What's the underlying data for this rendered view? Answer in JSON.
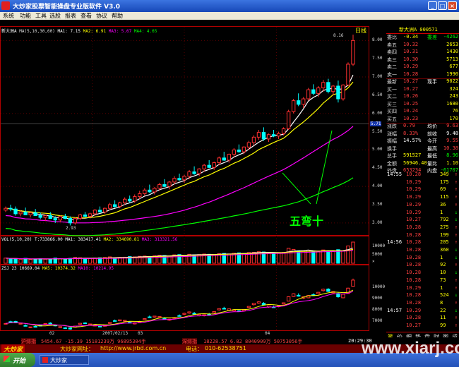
{
  "window": {
    "title": "大炒家股票智能操盘专业版软件 V3.0",
    "buttons": {
      "minimize": "_",
      "maximize": "□",
      "close": "×"
    }
  },
  "menu": [
    "系统",
    "功能",
    "工具",
    "选股",
    "报表",
    "查看",
    "协议",
    "帮助"
  ],
  "chart": {
    "stock_name": "新大洲A",
    "period_label": "日线",
    "ma_labels": {
      "header": "MA(5,10,30,60)",
      "ma1": "MA1: 7.15",
      "ma2": "MA2: 6.91",
      "ma3": "MA3: 5.67",
      "ma4": "MA4: 4.65"
    },
    "price_axis": [
      "8.00",
      "7.50",
      "7.00",
      "6.50",
      "6.00",
      "5.50",
      "5.00",
      "4.50",
      "4.00",
      "3.50",
      "3.00"
    ],
    "high_label": "8.16",
    "low_label": "2.93",
    "crosshair_value": "5.71",
    "annotation": "五弯十",
    "vol_labels": {
      "header": "VOL(5,10,20)",
      "total": "T:733866.00",
      "ma1": "MA1: 383417.41",
      "ma2": "MA2: 334690.81",
      "ma3": "MA3: 313321.56"
    },
    "vol_axis": [
      "10000",
      "5000"
    ],
    "vol_unit": "×",
    "lower_labels": {
      "header": "ZSJ 23",
      "v1": "10669.04",
      "ma5": "MA5: 10374.32",
      "ma10": "MA10: 10214.95"
    },
    "lower_axis": [
      "10000",
      "9000",
      "8000",
      "7000"
    ],
    "date_labels": [
      "02",
      "2007/02/13",
      "03",
      "04"
    ]
  },
  "chart_data": {
    "type": "candlestick",
    "title": "新大洲A 日线",
    "y_unit": "price",
    "ylim": [
      2.9,
      8.2
    ],
    "candles": [
      [
        3.35,
        3.45,
        3.3,
        3.4
      ],
      [
        3.4,
        3.5,
        3.32,
        3.38
      ],
      [
        3.38,
        3.45,
        3.2,
        3.25
      ],
      [
        3.25,
        3.35,
        3.18,
        3.3
      ],
      [
        3.3,
        3.42,
        3.25,
        3.22
      ],
      [
        3.22,
        3.3,
        3.15,
        3.28
      ],
      [
        3.28,
        3.38,
        3.22,
        3.2
      ],
      [
        3.2,
        3.28,
        3.1,
        3.15
      ],
      [
        3.15,
        3.22,
        3.05,
        3.2
      ],
      [
        3.2,
        3.3,
        3.12,
        3.12
      ],
      [
        3.12,
        3.18,
        3.0,
        3.08
      ],
      [
        3.08,
        3.2,
        3.02,
        3.18
      ],
      [
        3.18,
        3.25,
        3.1,
        3.12
      ],
      [
        3.12,
        3.18,
        2.93,
        3.0
      ],
      [
        3.0,
        3.15,
        2.95,
        3.12
      ],
      [
        3.12,
        3.25,
        3.08,
        3.22
      ],
      [
        3.22,
        3.3,
        3.15,
        3.18
      ],
      [
        3.18,
        3.28,
        3.12,
        3.25
      ],
      [
        3.25,
        3.38,
        3.2,
        3.35
      ],
      [
        3.35,
        3.45,
        3.28,
        3.3
      ],
      [
        3.3,
        3.42,
        3.25,
        3.4
      ],
      [
        3.4,
        3.55,
        3.35,
        3.5
      ],
      [
        3.5,
        3.62,
        3.42,
        3.45
      ],
      [
        3.45,
        3.58,
        3.4,
        3.55
      ],
      [
        3.55,
        3.7,
        3.5,
        3.65
      ],
      [
        3.65,
        3.75,
        3.55,
        3.6
      ],
      [
        3.6,
        3.78,
        3.55,
        3.72
      ],
      [
        3.72,
        3.88,
        3.65,
        3.8
      ],
      [
        3.8,
        3.95,
        3.75,
        3.9
      ],
      [
        3.9,
        4.05,
        3.82,
        3.85
      ],
      [
        3.85,
        3.98,
        3.78,
        3.95
      ],
      [
        3.95,
        4.1,
        3.88,
        4.05
      ],
      [
        4.05,
        4.2,
        3.98,
        4.0
      ],
      [
        4.0,
        4.15,
        3.92,
        4.12
      ],
      [
        4.12,
        4.28,
        4.05,
        4.22
      ],
      [
        4.22,
        4.35,
        4.15,
        4.18
      ],
      [
        4.18,
        4.32,
        4.1,
        4.28
      ],
      [
        4.28,
        4.45,
        4.2,
        4.4
      ],
      [
        4.4,
        4.55,
        4.32,
        4.35
      ],
      [
        4.35,
        4.5,
        4.28,
        4.48
      ],
      [
        4.48,
        4.62,
        4.4,
        4.58
      ],
      [
        4.58,
        4.72,
        4.5,
        4.52
      ],
      [
        4.52,
        4.68,
        4.45,
        4.65
      ],
      [
        4.65,
        4.82,
        4.58,
        4.78
      ],
      [
        4.78,
        4.95,
        4.7,
        4.72
      ],
      [
        4.72,
        4.9,
        4.65,
        4.88
      ],
      [
        4.88,
        5.05,
        4.8,
        5.0
      ],
      [
        5.0,
        5.15,
        4.92,
        4.95
      ],
      [
        4.95,
        5.1,
        4.88,
        5.08
      ],
      [
        5.08,
        5.25,
        5.0,
        5.2
      ],
      [
        5.2,
        5.4,
        5.12,
        5.35
      ],
      [
        5.35,
        5.55,
        5.28,
        5.48
      ],
      [
        5.48,
        5.62,
        5.25,
        5.3
      ],
      [
        5.3,
        5.45,
        5.22,
        5.42
      ],
      [
        5.42,
        5.55,
        5.35,
        5.38
      ],
      [
        5.38,
        5.5,
        5.3,
        5.45
      ],
      [
        5.45,
        5.62,
        5.4,
        5.58
      ],
      [
        5.58,
        6.1,
        5.55,
        6.05
      ],
      [
        6.05,
        6.4,
        6.0,
        6.35
      ],
      [
        6.35,
        6.55,
        6.2,
        6.25
      ],
      [
        6.25,
        6.45,
        6.15,
        6.4
      ],
      [
        6.4,
        6.7,
        6.35,
        6.65
      ],
      [
        6.65,
        6.8,
        6.5,
        6.55
      ],
      [
        6.55,
        6.75,
        6.45,
        6.7
      ],
      [
        6.7,
        6.92,
        6.6,
        6.85
      ],
      [
        6.85,
        6.95,
        6.55,
        6.6
      ],
      [
        6.6,
        6.78,
        6.5,
        6.75
      ],
      [
        6.75,
        6.9,
        6.3,
        6.4
      ],
      [
        6.4,
        6.8,
        6.35,
        6.78
      ],
      [
        6.78,
        7.4,
        6.75,
        7.35
      ],
      [
        7.35,
        8.16,
        7.3,
        8.0
      ]
    ],
    "volume": [
      180,
      160,
      150,
      140,
      170,
      130,
      150,
      160,
      140,
      150,
      180,
      160,
      150,
      170,
      200,
      190,
      170,
      160,
      180,
      190,
      200,
      220,
      190,
      200,
      210,
      230,
      220,
      240,
      250,
      230,
      260,
      280,
      270,
      250,
      290,
      300,
      280,
      310,
      290,
      300,
      320,
      310,
      300,
      330,
      340,
      320,
      350,
      360,
      340,
      370,
      380,
      400,
      390,
      360,
      350,
      370,
      380,
      520,
      480,
      430,
      410,
      450,
      400,
      420,
      460,
      430,
      410,
      470,
      440,
      600,
      734
    ],
    "ma_series": [
      {
        "name": "MA1",
        "period": 5,
        "color": "#ffffff"
      },
      {
        "name": "MA2",
        "period": 10,
        "color": "#ffff00"
      },
      {
        "name": "MA3",
        "period": 30,
        "color": "#ff00ff"
      },
      {
        "name": "MA4",
        "period": 60,
        "color": "#00ff00"
      }
    ]
  },
  "right_panel": {
    "header_code": "新大洲A 000571",
    "rows": [
      {
        "label": "委比",
        "v1": "-0.34",
        "v2": "委差",
        "v3": "-4262",
        "c1": "#ffff00",
        "c2": "#00ff00",
        "c3": "#00ff00"
      },
      {
        "label": "卖五",
        "v1": "10.32",
        "v2": "",
        "v3": "2653",
        "c1": "#ff4040",
        "c2": "#ff4040",
        "c3": "#ffff00"
      },
      {
        "label": "卖四",
        "v1": "10.31",
        "v2": "",
        "v3": "1430",
        "c1": "#ff4040",
        "c2": "#ff4040",
        "c3": "#ffff00"
      },
      {
        "label": "卖三",
        "v1": "10.30",
        "v2": "",
        "v3": "5713",
        "c1": "#ff4040",
        "c2": "#ff4040",
        "c3": "#ffff00"
      },
      {
        "label": "卖二",
        "v1": "10.29",
        "v2": "",
        "v3": "677",
        "c1": "#ff4040",
        "c2": "#ff4040",
        "c3": "#ffff00"
      },
      {
        "label": "卖一",
        "v1": "10.28",
        "v2": "",
        "v3": "1990",
        "c1": "#ff4040",
        "c2": "#ff4040",
        "c3": "#ffff00"
      },
      {
        "label": "最新",
        "v1": "10.27",
        "v2": "现手",
        "v3": "9022",
        "c1": "#ff4040",
        "c2": "#ffffff",
        "c3": "#ffff00"
      },
      {
        "label": "买一",
        "v1": "10.27",
        "v2": "",
        "v3": "324",
        "c1": "#ff4040",
        "c2": "#ff4040",
        "c3": "#ffff00"
      },
      {
        "label": "买二",
        "v1": "10.26",
        "v2": "",
        "v3": "243",
        "c1": "#ff4040",
        "c2": "#ff4040",
        "c3": "#ffff00"
      },
      {
        "label": "买三",
        "v1": "10.25",
        "v2": "",
        "v3": "1680",
        "c1": "#ff4040",
        "c2": "#ff4040",
        "c3": "#ffff00"
      },
      {
        "label": "买四",
        "v1": "10.24",
        "v2": "",
        "v3": "76",
        "c1": "#ff4040",
        "c2": "#ff4040",
        "c3": "#ffff00"
      },
      {
        "label": "买五",
        "v1": "10.23",
        "v2": "",
        "v3": "170",
        "c1": "#ff4040",
        "c2": "#ff4040",
        "c3": "#ffff00"
      },
      {
        "label": "涨跌",
        "v1": "0.79",
        "v2": "均价",
        "v3": "9.63",
        "c1": "#ff4040",
        "c2": "#ffffff",
        "c3": "#ff4040"
      },
      {
        "label": "涨幅",
        "v1": "8.33%",
        "v2": "前收",
        "v3": "9.48",
        "c1": "#ff4040",
        "c2": "#ffffff",
        "c3": "#ffffff"
      },
      {
        "label": "振幅",
        "v1": "14.57%",
        "v2": "今开",
        "v3": "9.55",
        "c1": "#ffffff",
        "c2": "#ffffff",
        "c3": "#ff4040"
      },
      {
        "label": "换手",
        "v1": "",
        "v2": "最高",
        "v3": "10.38",
        "c1": "#ffffff",
        "c2": "#ffffff",
        "c3": "#ff4040"
      },
      {
        "label": "总手",
        "v1": "591527",
        "v2": "最低",
        "v3": "8.96",
        "c1": "#ffff00",
        "c2": "#ffffff",
        "c3": "#00ff00"
      },
      {
        "label": "金额",
        "v1": "56946.40",
        "v2": "量比",
        "v3": "1.10",
        "c1": "#ffff00",
        "c2": "#ffffff",
        "c3": "#ffff00"
      },
      {
        "label": "外盘",
        "v1": "653234",
        "v2": "内盘",
        "v3": "-61707",
        "c1": "#ff4040",
        "c2": "#ffffff",
        "c3": "#00ff00"
      }
    ],
    "ticks": [
      {
        "time": "14:55",
        "price": "10.28",
        "vol": "349",
        "dir": "↑"
      },
      {
        "time": "",
        "price": "10.29",
        "vol": "175",
        "dir": "↑"
      },
      {
        "time": "",
        "price": "10.29",
        "vol": "69",
        "dir": "↑"
      },
      {
        "time": "",
        "price": "10.29",
        "vol": "115",
        "dir": "↑"
      },
      {
        "time": "",
        "price": "10.29",
        "vol": "36",
        "dir": "↑"
      },
      {
        "time": "",
        "price": "10.29",
        "vol": "1",
        "dir": "↓"
      },
      {
        "time": "",
        "price": "10.27",
        "vol": "792",
        "dir": "↓"
      },
      {
        "time": "",
        "price": "10.28",
        "vol": "275",
        "dir": "↑"
      },
      {
        "time": "",
        "price": "10.28",
        "vol": "199",
        "dir": "↑"
      },
      {
        "time": "14:56",
        "price": "10.28",
        "vol": "205",
        "dir": "↑"
      },
      {
        "time": "",
        "price": "10.28",
        "vol": "360",
        "dir": "↓"
      },
      {
        "time": "",
        "price": "10.28",
        "vol": "1",
        "dir": "↓"
      },
      {
        "time": "",
        "price": "10.28",
        "vol": "92",
        "dir": "↑"
      },
      {
        "time": "",
        "price": "10.28",
        "vol": "10",
        "dir": "↓"
      },
      {
        "time": "",
        "price": "10.28",
        "vol": "73",
        "dir": "↑"
      },
      {
        "time": "",
        "price": "10.29",
        "vol": "1",
        "dir": "↑"
      },
      {
        "time": "",
        "price": "10.28",
        "vol": "524",
        "dir": "↓"
      },
      {
        "time": "",
        "price": "10.28",
        "vol": "8",
        "dir": "↑"
      },
      {
        "time": "14:57",
        "price": "10.29",
        "vol": "22",
        "dir": "↓"
      },
      {
        "time": "",
        "price": "10.28",
        "vol": "11",
        "dir": "↑"
      },
      {
        "time": "",
        "price": "10.27",
        "vol": "99",
        "dir": "↑"
      }
    ]
  },
  "tabs": [
    "笔",
    "价",
    "细",
    "势",
    "盘",
    "财",
    "图",
    "成"
  ],
  "status": {
    "sh_label": "沪综指",
    "sh_values": "5454.67  -15.39  15181239万  96895304手",
    "sz_label": "深综指",
    "sz_values": "18228.57  6.82  8040909万  50753056手",
    "time": "20:29:30"
  },
  "banner": {
    "logo": "大炒家",
    "site_label": "大炒家网址：",
    "site": "http://www.jrbd.com.cn",
    "phone_label": "电话：",
    "phone": "010-62538751"
  },
  "taskbar": {
    "start": "开始",
    "app": "大炒家"
  },
  "watermark": "www.xiarj.com"
}
